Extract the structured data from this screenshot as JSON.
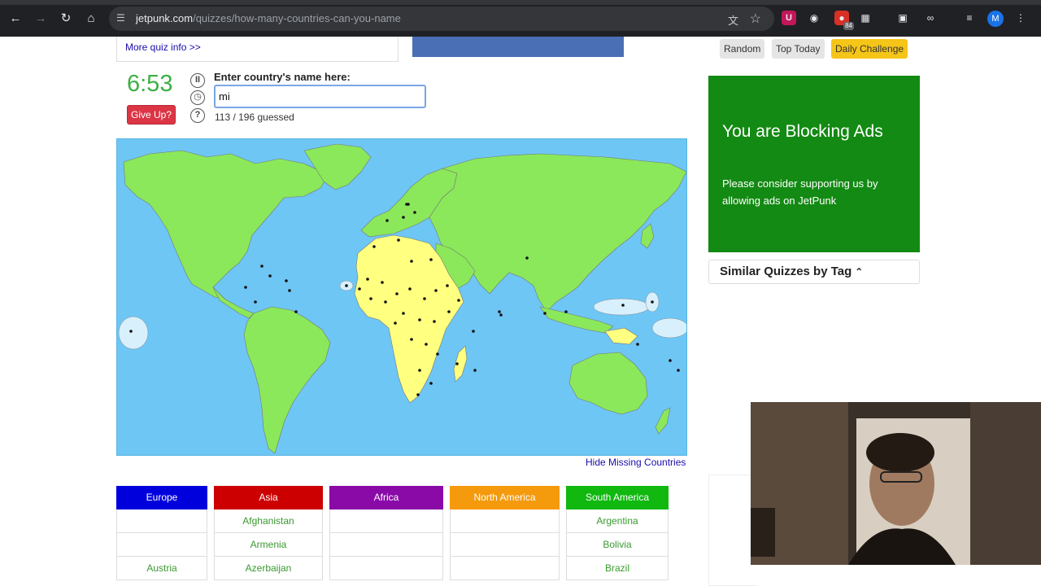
{
  "browser": {
    "url_domain": "jetpunk.com",
    "url_path": "/quizzes/how-many-countries-can-you-name",
    "extension_badge": "84",
    "profile_initial": "M"
  },
  "quiz": {
    "more_info_link": "More quiz info >>",
    "timer": "6:53",
    "give_up_label": "Give Up?",
    "input_label": "Enter country's name here:",
    "input_value": "mi",
    "guessed_text": "113 / 196 guessed",
    "hide_missing_link": "Hide Missing Countries"
  },
  "sidebar": {
    "random_label": "Random",
    "top_today_label": "Top Today",
    "daily_challenge_label": "Daily Challenge",
    "adblock_title": "You are Blocking Ads",
    "adblock_message": "Please consider supporting us by allowing ads on JetPunk",
    "similar_quizzes": "Similar Quizzes by Tag"
  },
  "continents": [
    {
      "name": "Europe",
      "color": "#0000dd",
      "cells": [
        "",
        "",
        "Austria"
      ]
    },
    {
      "name": "Asia",
      "color": "#cc0000",
      "cells": [
        "Afghanistan",
        "Armenia",
        "Azerbaijan"
      ]
    },
    {
      "name": "Africa",
      "color": "#8a0aa8",
      "cells": [
        "",
        "",
        ""
      ]
    },
    {
      "name": "North America",
      "color": "#f59a0c",
      "cells": [
        "",
        "",
        ""
      ]
    },
    {
      "name": "South America",
      "color": "#10b810",
      "cells": [
        "Argentina",
        "Bolivia",
        "Brazil"
      ]
    }
  ],
  "colors": {
    "land_guessed": "#8be85a",
    "land_missing": "#ffff80",
    "ocean": "#6ec6f5",
    "timer": "#3cb043",
    "adblock_bg": "#138a13"
  }
}
